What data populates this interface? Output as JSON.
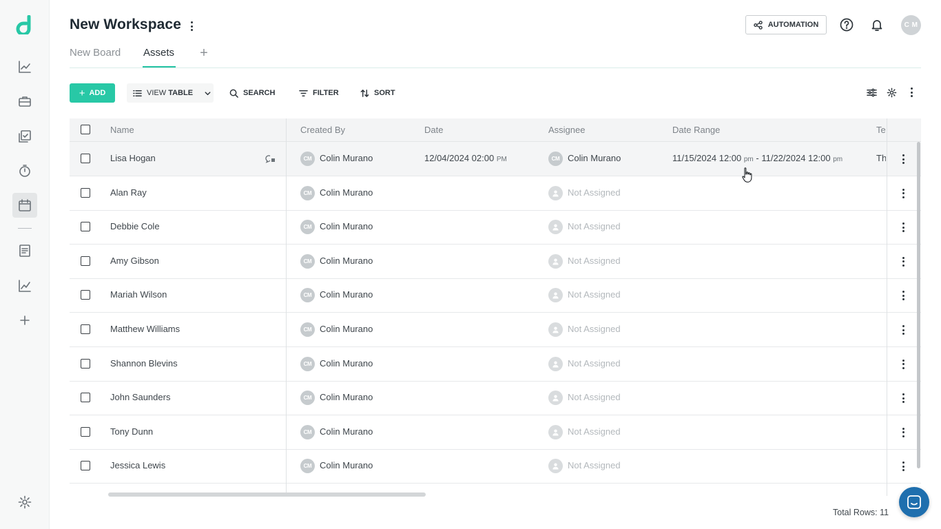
{
  "sidebar": {
    "logo_letter": "d",
    "accent_color": "#28c8a6",
    "icons": [
      "chart-line-icon",
      "briefcase-icon",
      "checklist-icon",
      "timer-icon",
      "calendar-icon",
      "document-icon",
      "analytics-icon",
      "plus-icon",
      "gear-icon"
    ],
    "active_icon": "calendar-icon"
  },
  "header": {
    "workspace_title": "New Workspace",
    "automation_label": "AUTOMATION",
    "avatar_initials": "C M"
  },
  "tabs": [
    {
      "label": "New Board",
      "active": false
    },
    {
      "label": "Assets",
      "active": true
    }
  ],
  "toolbar": {
    "add_label": "ADD",
    "view_prefix": "VIEW",
    "view_value": "TABLE",
    "search_label": "SEARCH",
    "filter_label": "FILTER",
    "sort_label": "SORT"
  },
  "table": {
    "columns": [
      "Name",
      "Created By",
      "Date",
      "Assignee",
      "Date Range",
      "Te"
    ],
    "rows": [
      {
        "name": "Lisa Hogan",
        "created_by_initials": "CM",
        "created_by": "Colin Murano",
        "date": "12/04/2024 02:00",
        "date_ampm": "PM",
        "assignee_initials": "CM",
        "assignee": "Colin Murano",
        "assigned": true,
        "range_start": "11/15/2024 12:00",
        "range_start_ampm": "pm",
        "range_sep": " - ",
        "range_end": "11/22/2024 12:00",
        "range_end_ampm": "pm",
        "extra": "Th"
      },
      {
        "name": "Alan Ray",
        "created_by_initials": "CM",
        "created_by": "Colin Murano",
        "assignee": "Not Assigned",
        "assigned": false
      },
      {
        "name": "Debbie Cole",
        "created_by_initials": "CM",
        "created_by": "Colin Murano",
        "assignee": "Not Assigned",
        "assigned": false
      },
      {
        "name": "Amy Gibson",
        "created_by_initials": "CM",
        "created_by": "Colin Murano",
        "assignee": "Not Assigned",
        "assigned": false
      },
      {
        "name": "Mariah Wilson",
        "created_by_initials": "CM",
        "created_by": "Colin Murano",
        "assignee": "Not Assigned",
        "assigned": false
      },
      {
        "name": "Matthew Williams",
        "created_by_initials": "CM",
        "created_by": "Colin Murano",
        "assignee": "Not Assigned",
        "assigned": false
      },
      {
        "name": "Shannon Blevins",
        "created_by_initials": "CM",
        "created_by": "Colin Murano",
        "assignee": "Not Assigned",
        "assigned": false
      },
      {
        "name": "John Saunders",
        "created_by_initials": "CM",
        "created_by": "Colin Murano",
        "assignee": "Not Assigned",
        "assigned": false
      },
      {
        "name": "Tony Dunn",
        "created_by_initials": "CM",
        "created_by": "Colin Murano",
        "assignee": "Not Assigned",
        "assigned": false
      },
      {
        "name": "Jessica Lewis",
        "created_by_initials": "CM",
        "created_by": "Colin Murano",
        "assignee": "Not Assigned",
        "assigned": false
      }
    ]
  },
  "footer": {
    "total_rows": "Total Rows: 11"
  }
}
